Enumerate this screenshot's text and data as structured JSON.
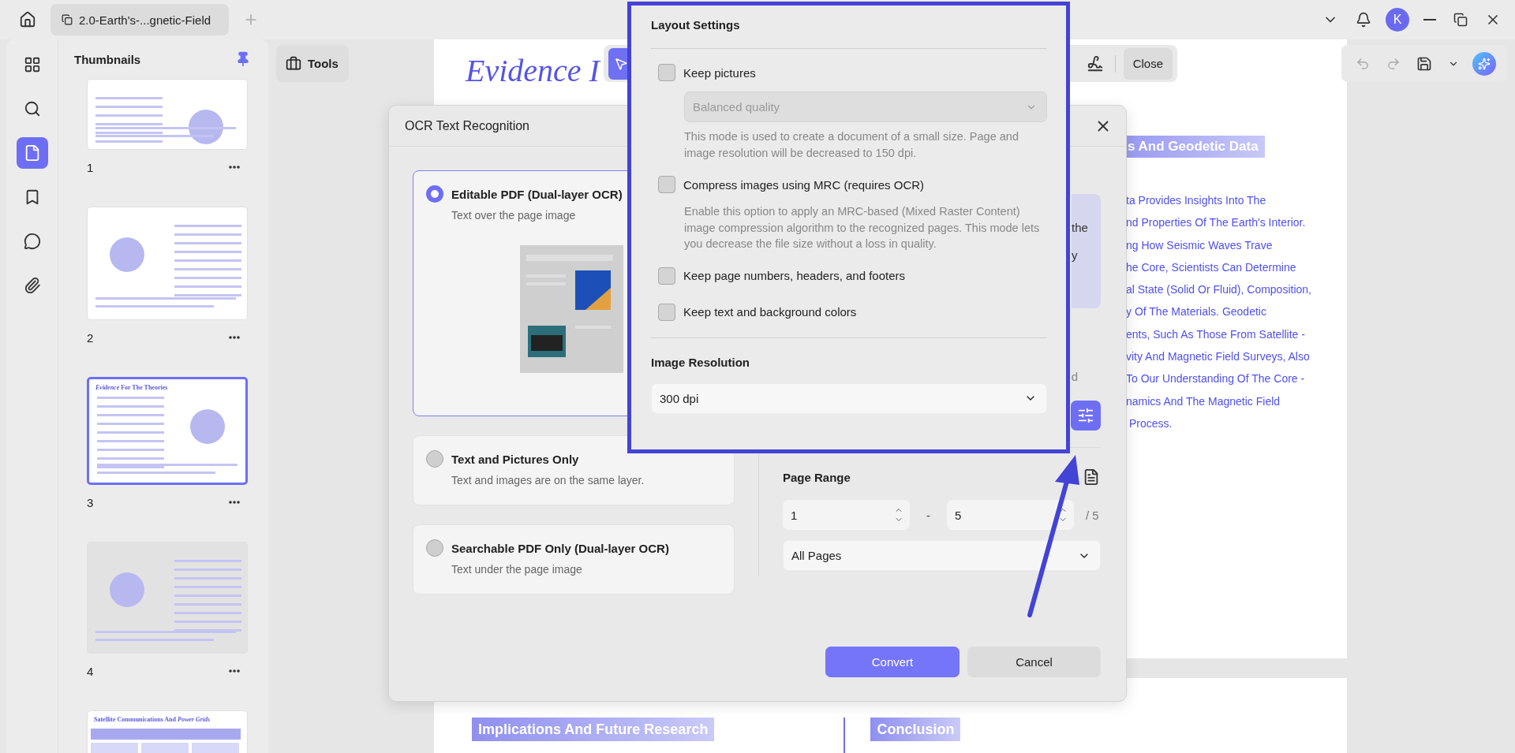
{
  "titlebar": {
    "tab_title": "2.0-Earth's-...gnetic-Field",
    "avatar": "K"
  },
  "nav_rail": [
    {
      "selected": false
    },
    {
      "selected": false
    },
    {
      "selected": true
    },
    {
      "selected": false
    },
    {
      "selected": false
    },
    {
      "selected": false
    }
  ],
  "thumbnails": {
    "title": "Thumbnails",
    "pages": [
      {
        "label": "1",
        "selected": false
      },
      {
        "label": "2",
        "selected": false
      },
      {
        "label": "3",
        "selected": true,
        "title": "*Evidence* For The Theories"
      },
      {
        "label": "4",
        "selected": false
      },
      {
        "selected": false,
        "title": "Satellite Communications And *Power Grids*"
      }
    ]
  },
  "toolbar": {
    "tools": "Tools",
    "select_tool": {
      "selected": true
    },
    "close": "Close"
  },
  "document": {
    "page_title": "Evidence I",
    "section_heading": "s And Geodetic Data",
    "lines": [
      "ta Provides Insights Into The",
      "nd Properties Of The Earth's Interior.",
      "ng How Seismic Waves Trave",
      "he Core, Scientists Can Determine",
      "al State (Solid Or Fluid), Composition,",
      "y Of The Materials. Geodetic",
      "ents, Such As Those From Satellite -",
      "vity And Magnetic Field Surveys, Also",
      "To Our Understanding Of The Core -",
      "namics And The Magnetic Field",
      " Process."
    ],
    "next_page_headings": [
      "Implications And Future Research",
      "Conclusion"
    ]
  },
  "ocr_dialog": {
    "title": "OCR Text Recognition",
    "modes": [
      {
        "title": "Editable PDF (Dual-layer OCR)",
        "subtitle": "Text over the page image",
        "selected": true
      },
      {
        "title": "Text and Pictures Only",
        "subtitle": "Text and images are on the same layer.",
        "selected": false
      },
      {
        "title": "Searchable PDF Only (Dual-layer OCR)",
        "subtitle": "Text under the page image",
        "selected": false
      }
    ],
    "info_card_fragments": [
      "the",
      "y"
    ],
    "note_fragment": "d",
    "page_range": {
      "label": "Page Range",
      "from": "1",
      "dash": "-",
      "to": "5",
      "total": "/ 5",
      "scope": "All Pages"
    },
    "convert": "Convert",
    "cancel": "Cancel"
  },
  "layout_settings": {
    "title": "Layout Settings",
    "options": [
      {
        "label": "Keep pictures",
        "checked": false,
        "quality": {
          "value": "Balanced quality",
          "disabled": true
        },
        "description": "This mode is used to create a document of a small size. Page and image resolution will be decreased to 150 dpi."
      },
      {
        "label": "Compress images using MRC (requires OCR)",
        "checked": false,
        "description": "Enable this option to apply an MRC-based (Mixed Raster Content) image compression algorithm to the recognized pages. This mode lets you decrease the file size without a loss in quality."
      },
      {
        "label": "Keep page numbers, headers, and footers",
        "checked": false
      },
      {
        "label": "Keep text and background colors",
        "checked": false
      }
    ],
    "resolution_label": "Image Resolution",
    "resolution": "300 dpi"
  }
}
